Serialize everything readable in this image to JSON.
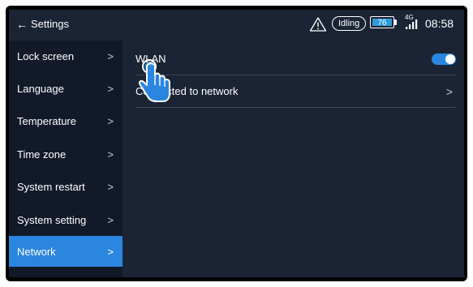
{
  "statusbar": {
    "back_arrow": "←",
    "back_label": "Settings",
    "warning_icon": "warning-triangle-icon",
    "state_label": "Idling",
    "battery_level": "76",
    "network_type": "4G",
    "time": "08:58"
  },
  "sidebar": {
    "items": [
      {
        "label": "Lock screen",
        "chevron": ">"
      },
      {
        "label": "Language",
        "chevron": ">"
      },
      {
        "label": "Temperature",
        "chevron": ">"
      },
      {
        "label": "Time zone",
        "chevron": ">"
      },
      {
        "label": "System restart",
        "chevron": ">"
      },
      {
        "label": "System setting",
        "chevron": ">"
      },
      {
        "label": "Network",
        "chevron": ">",
        "active": true
      }
    ]
  },
  "main": {
    "wlan_label": "WLAN",
    "wlan_enabled": true,
    "connected_label": "Connected to network",
    "connected_chevron": ">"
  },
  "colors": {
    "screen_bg": "#1b2435",
    "sidebar_bg": "#121a29",
    "accent": "#2b86e0",
    "battery_fill": "#2f9bdc"
  },
  "overlay": {
    "pointer_icon": "tap-hand-icon"
  }
}
